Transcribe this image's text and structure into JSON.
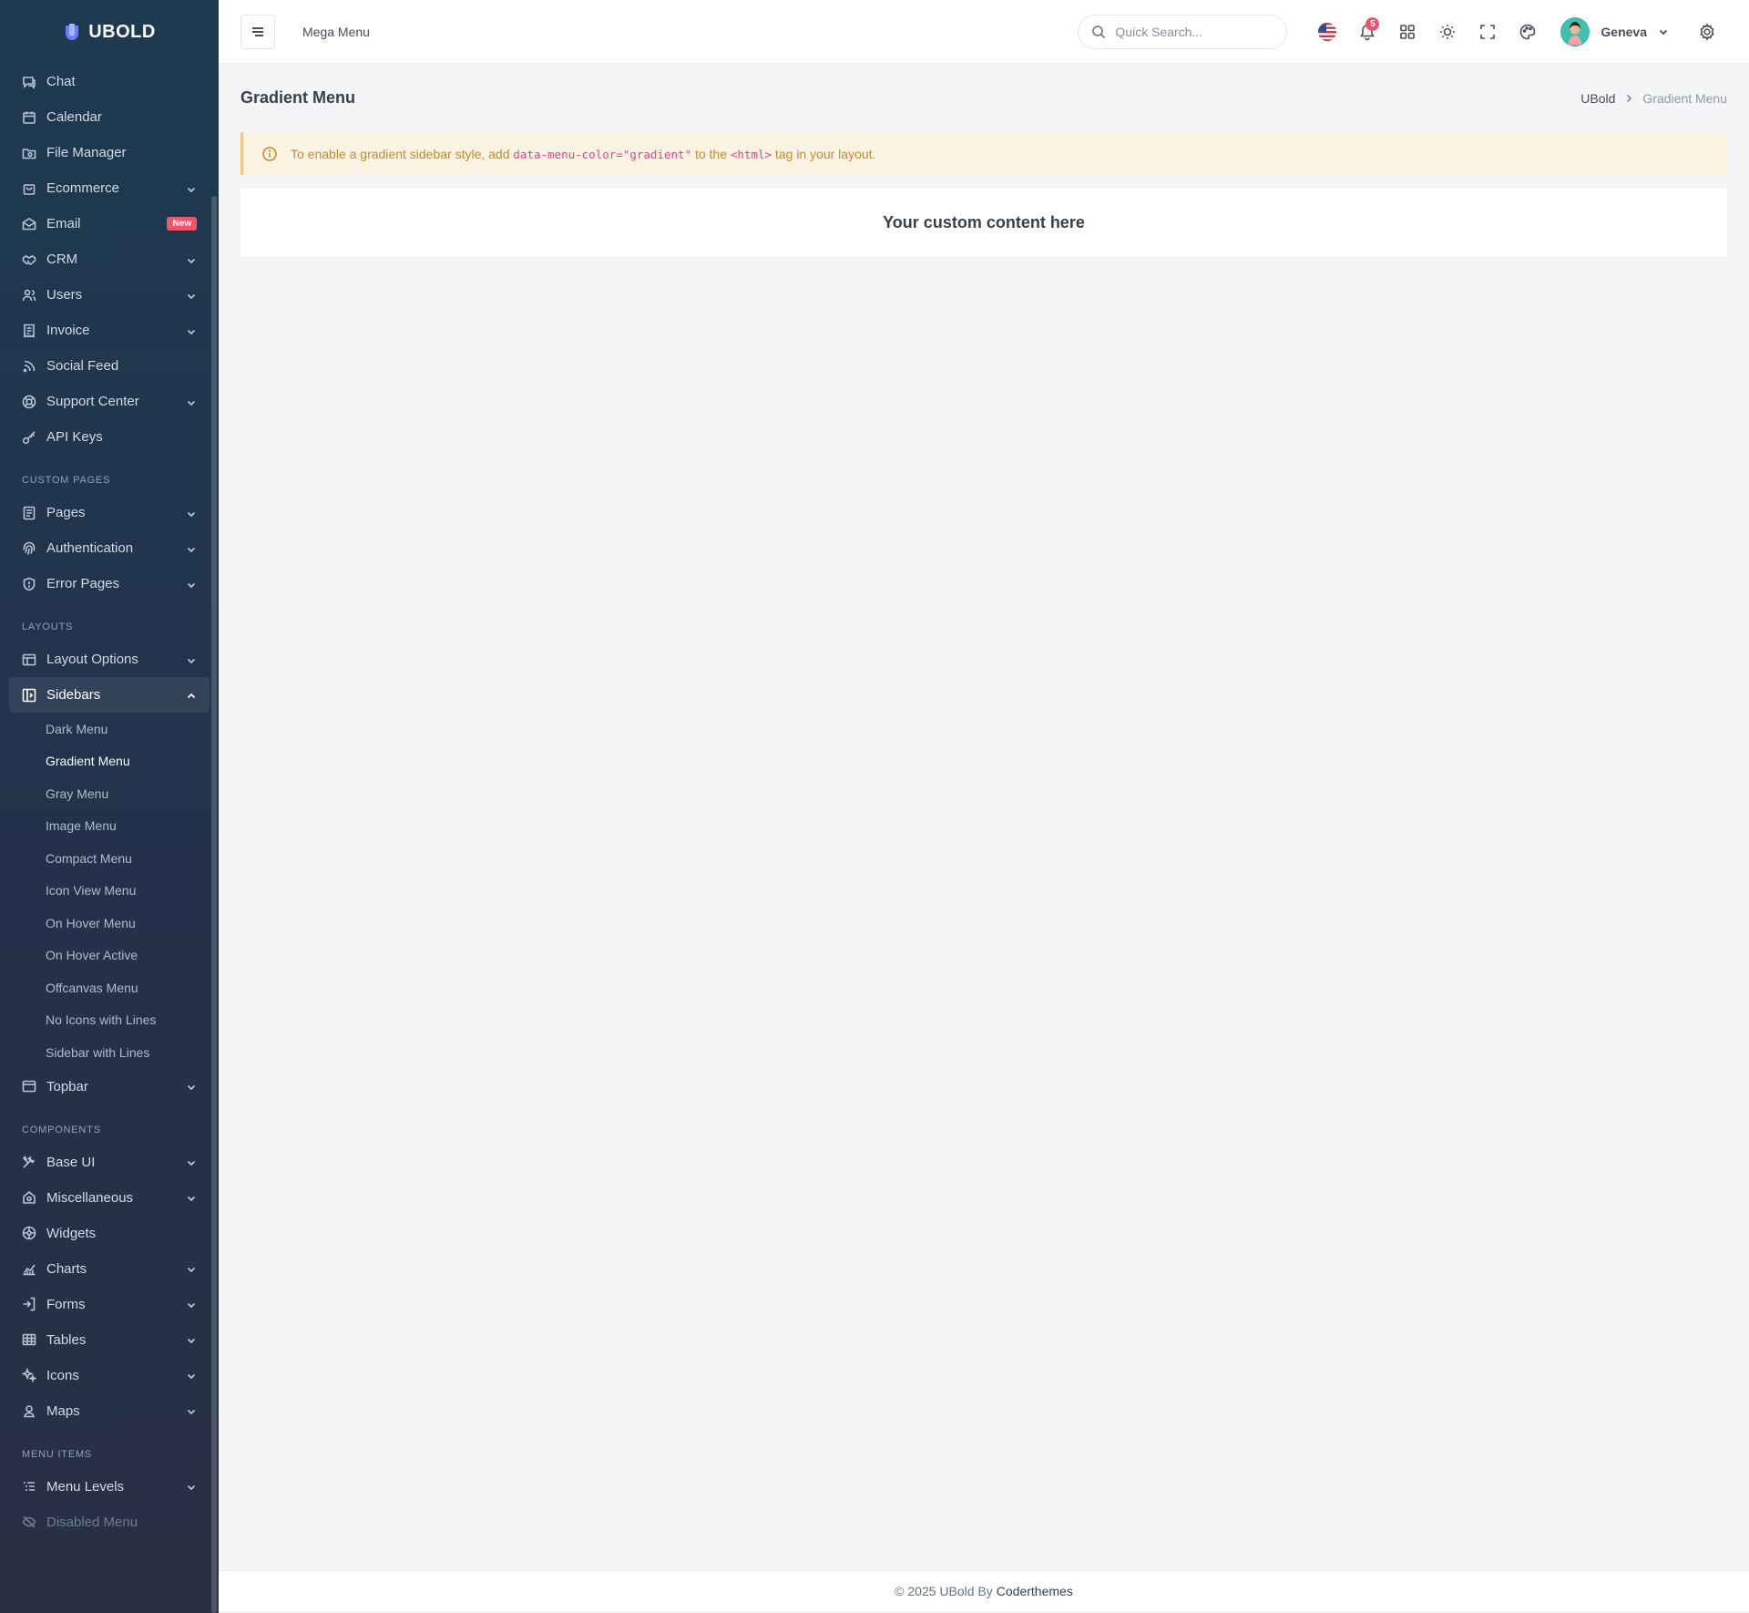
{
  "brand": {
    "name": "UBOLD"
  },
  "sidebar": {
    "items_top": [
      {
        "label": "Chat",
        "icon": "chat-icon",
        "chevron": false
      },
      {
        "label": "Calendar",
        "icon": "calendar-icon",
        "chevron": false
      },
      {
        "label": "File Manager",
        "icon": "folder-icon",
        "chevron": false
      },
      {
        "label": "Ecommerce",
        "icon": "bag-icon",
        "chevron": true
      },
      {
        "label": "Email",
        "icon": "mail-icon",
        "chevron": false,
        "badge": "New"
      },
      {
        "label": "CRM",
        "icon": "handshake-icon",
        "chevron": true
      },
      {
        "label": "Users",
        "icon": "users-icon",
        "chevron": true
      },
      {
        "label": "Invoice",
        "icon": "invoice-icon",
        "chevron": true
      },
      {
        "label": "Social Feed",
        "icon": "rss-icon",
        "chevron": false
      },
      {
        "label": "Support Center",
        "icon": "lifebuoy-icon",
        "chevron": true
      },
      {
        "label": "API Keys",
        "icon": "key-icon",
        "chevron": false
      }
    ],
    "section_custom": "Custom Pages",
    "items_custom": [
      {
        "label": "Pages",
        "icon": "page-icon",
        "chevron": true
      },
      {
        "label": "Authentication",
        "icon": "fingerprint-icon",
        "chevron": true
      },
      {
        "label": "Error Pages",
        "icon": "shield-icon",
        "chevron": true
      }
    ],
    "section_layouts": "Layouts",
    "layout_options": {
      "label": "Layout Options",
      "icon": "layout-icon"
    },
    "sidebars": {
      "label": "Sidebars",
      "icon": "sidebar-icon"
    },
    "sidebars_sub": [
      "Dark Menu",
      "Gradient Menu",
      "Gray Menu",
      "Image Menu",
      "Compact Menu",
      "Icon View Menu",
      "On Hover Menu",
      "On Hover Active",
      "Offcanvas Menu",
      "No Icons with Lines",
      "Sidebar with Lines"
    ],
    "sidebars_active_index": 1,
    "topbar": {
      "label": "Topbar",
      "icon": "topbar-icon"
    },
    "section_components": "Components",
    "items_components": [
      {
        "label": "Base UI",
        "icon": "tools-icon",
        "chevron": true
      },
      {
        "label": "Miscellaneous",
        "icon": "misc-icon",
        "chevron": true
      },
      {
        "label": "Widgets",
        "icon": "widgets-icon",
        "chevron": false
      },
      {
        "label": "Charts",
        "icon": "chart-icon",
        "chevron": true
      },
      {
        "label": "Forms",
        "icon": "form-icon",
        "chevron": true
      },
      {
        "label": "Tables",
        "icon": "table-icon",
        "chevron": true
      },
      {
        "label": "Icons",
        "icon": "sparkles-icon",
        "chevron": true
      },
      {
        "label": "Maps",
        "icon": "map-pin-icon",
        "chevron": true
      }
    ],
    "section_menu": "Menu Items",
    "menu_levels": {
      "label": "Menu Levels",
      "icon": "list-icon"
    },
    "disabled_menu": {
      "label": "Disabled Menu",
      "icon": "eye-off-icon"
    }
  },
  "topbar": {
    "mega_menu": "Mega Menu",
    "search_placeholder": "Quick Search...",
    "notification_count": "5",
    "user_name": "Geneva"
  },
  "page": {
    "title": "Gradient Menu",
    "breadcrumb": [
      "UBold",
      "Gradient Menu"
    ],
    "alert": {
      "prefix": "To enable a gradient sidebar style, add",
      "code1": "data-menu-color=\"gradient\"",
      "middle": "to the",
      "code2": "<html>",
      "suffix": "tag in your layout."
    },
    "card_text": "Your custom content here"
  },
  "footer": {
    "text": "© 2025 UBold By",
    "brand": "Coderthemes"
  },
  "colors": {
    "accent_red": "#f1556c",
    "alert_bg": "#fdf3e3",
    "alert_text": "#c18a2c"
  }
}
